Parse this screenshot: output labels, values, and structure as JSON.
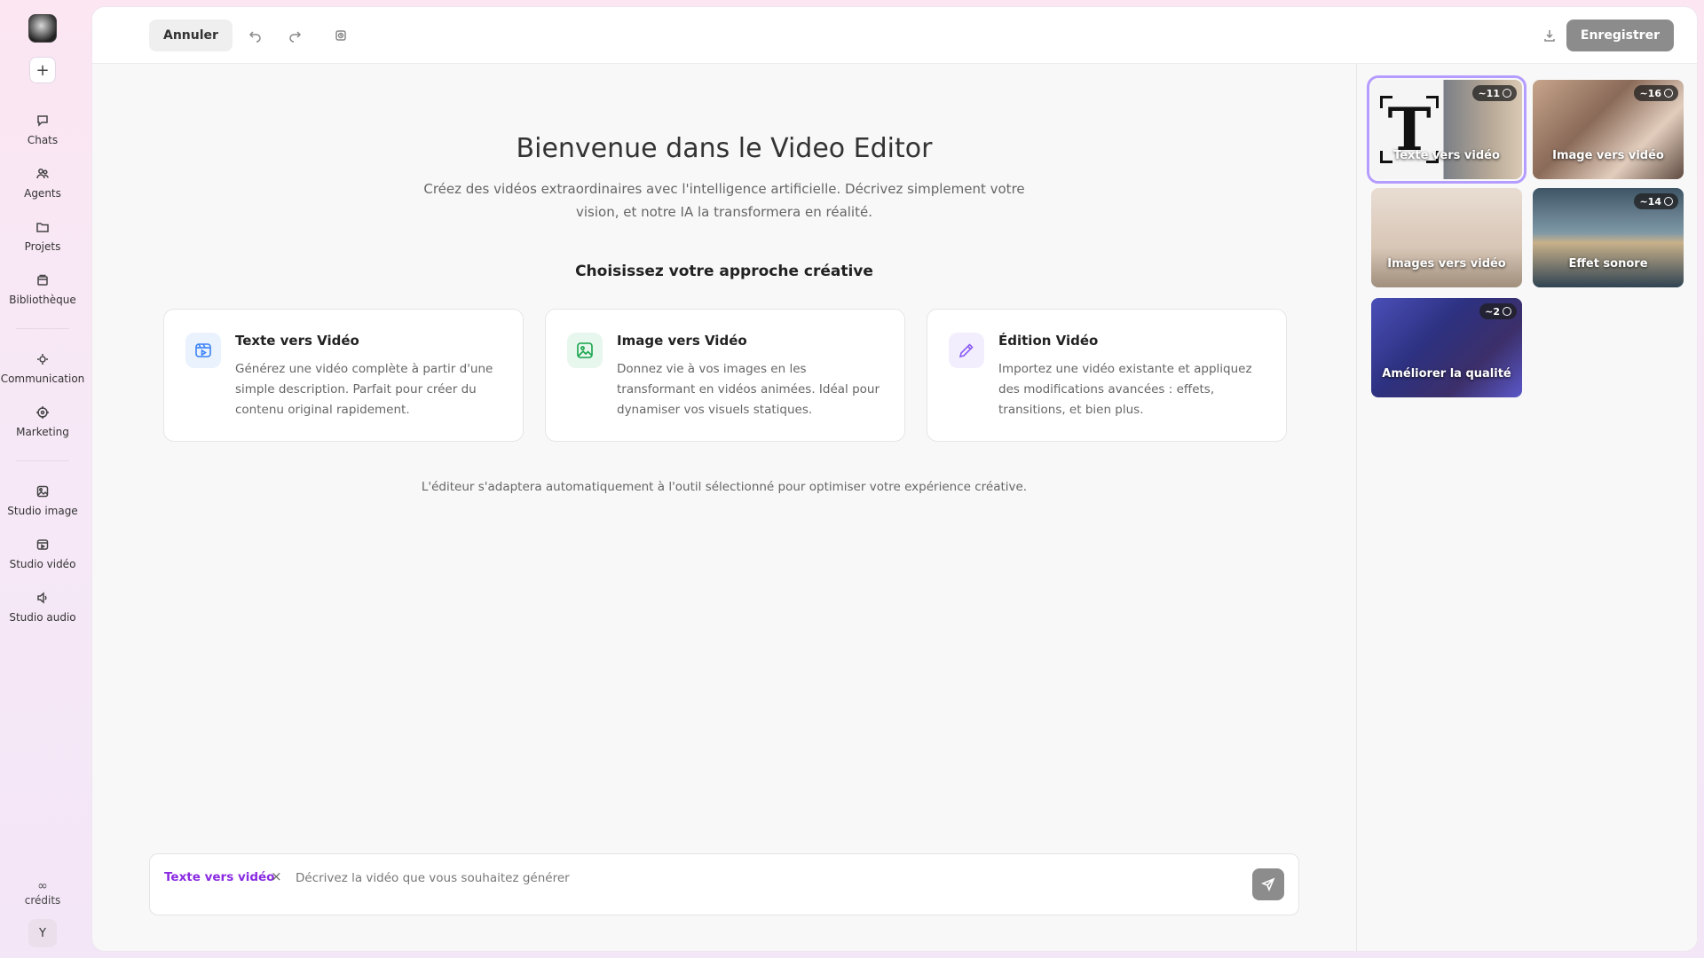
{
  "sidebar": {
    "new_label": "+",
    "group1": [
      {
        "label": "Chats",
        "icon": "chat-icon"
      },
      {
        "label": "Agents",
        "icon": "agents-icon"
      },
      {
        "label": "Projets",
        "icon": "folder-icon"
      },
      {
        "label": "Bibliothèque",
        "icon": "library-icon"
      }
    ],
    "group2": [
      {
        "label": "Communication",
        "icon": "communication-icon"
      },
      {
        "label": "Marketing",
        "icon": "marketing-icon"
      }
    ],
    "group3": [
      {
        "label": "Studio image",
        "icon": "image-studio-icon"
      },
      {
        "label": "Studio vidéo",
        "icon": "video-studio-icon"
      },
      {
        "label": "Studio audio",
        "icon": "audio-studio-icon"
      }
    ],
    "credits": {
      "symbol": "∞",
      "label": "crédits"
    },
    "avatar_initial": "Y"
  },
  "toolbar": {
    "cancel_label": "Annuler",
    "save_label": "Enregistrer"
  },
  "main": {
    "title": "Bienvenue dans le Video Editor",
    "subtitle": "Créez des vidéos extraordinaires avec l'intelligence artificielle. Décrivez simplement votre vision, et notre IA la transformera en réalité.",
    "section_title": "Choisissez votre approche créative",
    "cards": [
      {
        "title": "Texte vers Vidéo",
        "description": "Générez une vidéo complète à partir d'une simple description. Parfait pour créer du contenu original rapidement.",
        "icon": "video-icon",
        "color": "#3b82f6"
      },
      {
        "title": "Image vers Vidéo",
        "description": "Donnez vie à vos images en les transformant en vidéos animées. Idéal pour dynamiser vos visuels statiques.",
        "icon": "image-icon",
        "color": "#16a34a"
      },
      {
        "title": "Édition Vidéo",
        "description": "Importez une vidéo existante et appliquez des modifications avancées : effets, transitions, et bien plus.",
        "icon": "pencil-icon",
        "color": "#8b5cf6"
      }
    ],
    "hint": "L'éditeur s'adaptera automatiquement à l'outil sélectionné pour optimiser votre expérience créative."
  },
  "prompt": {
    "tag": "Texte vers vidéo",
    "remove_symbol": "×",
    "placeholder": "Décrivez la vidéo que vous souhaitez générer",
    "value": ""
  },
  "tools": [
    {
      "label": "Texte vers vidéo",
      "credits": "~11",
      "selected": true
    },
    {
      "label": "Image vers vidéo",
      "credits": "~16",
      "selected": false
    },
    {
      "label": "Images vers vidéo",
      "credits": "",
      "selected": false
    },
    {
      "label": "Effet sonore",
      "credits": "~14",
      "selected": false
    },
    {
      "label": "Améliorer la qualité",
      "credits": "~2",
      "selected": false
    }
  ],
  "colors": {
    "accent": "#8a2be2",
    "selected_outline": "#b59cff",
    "save_button": "#8c8c8c"
  }
}
